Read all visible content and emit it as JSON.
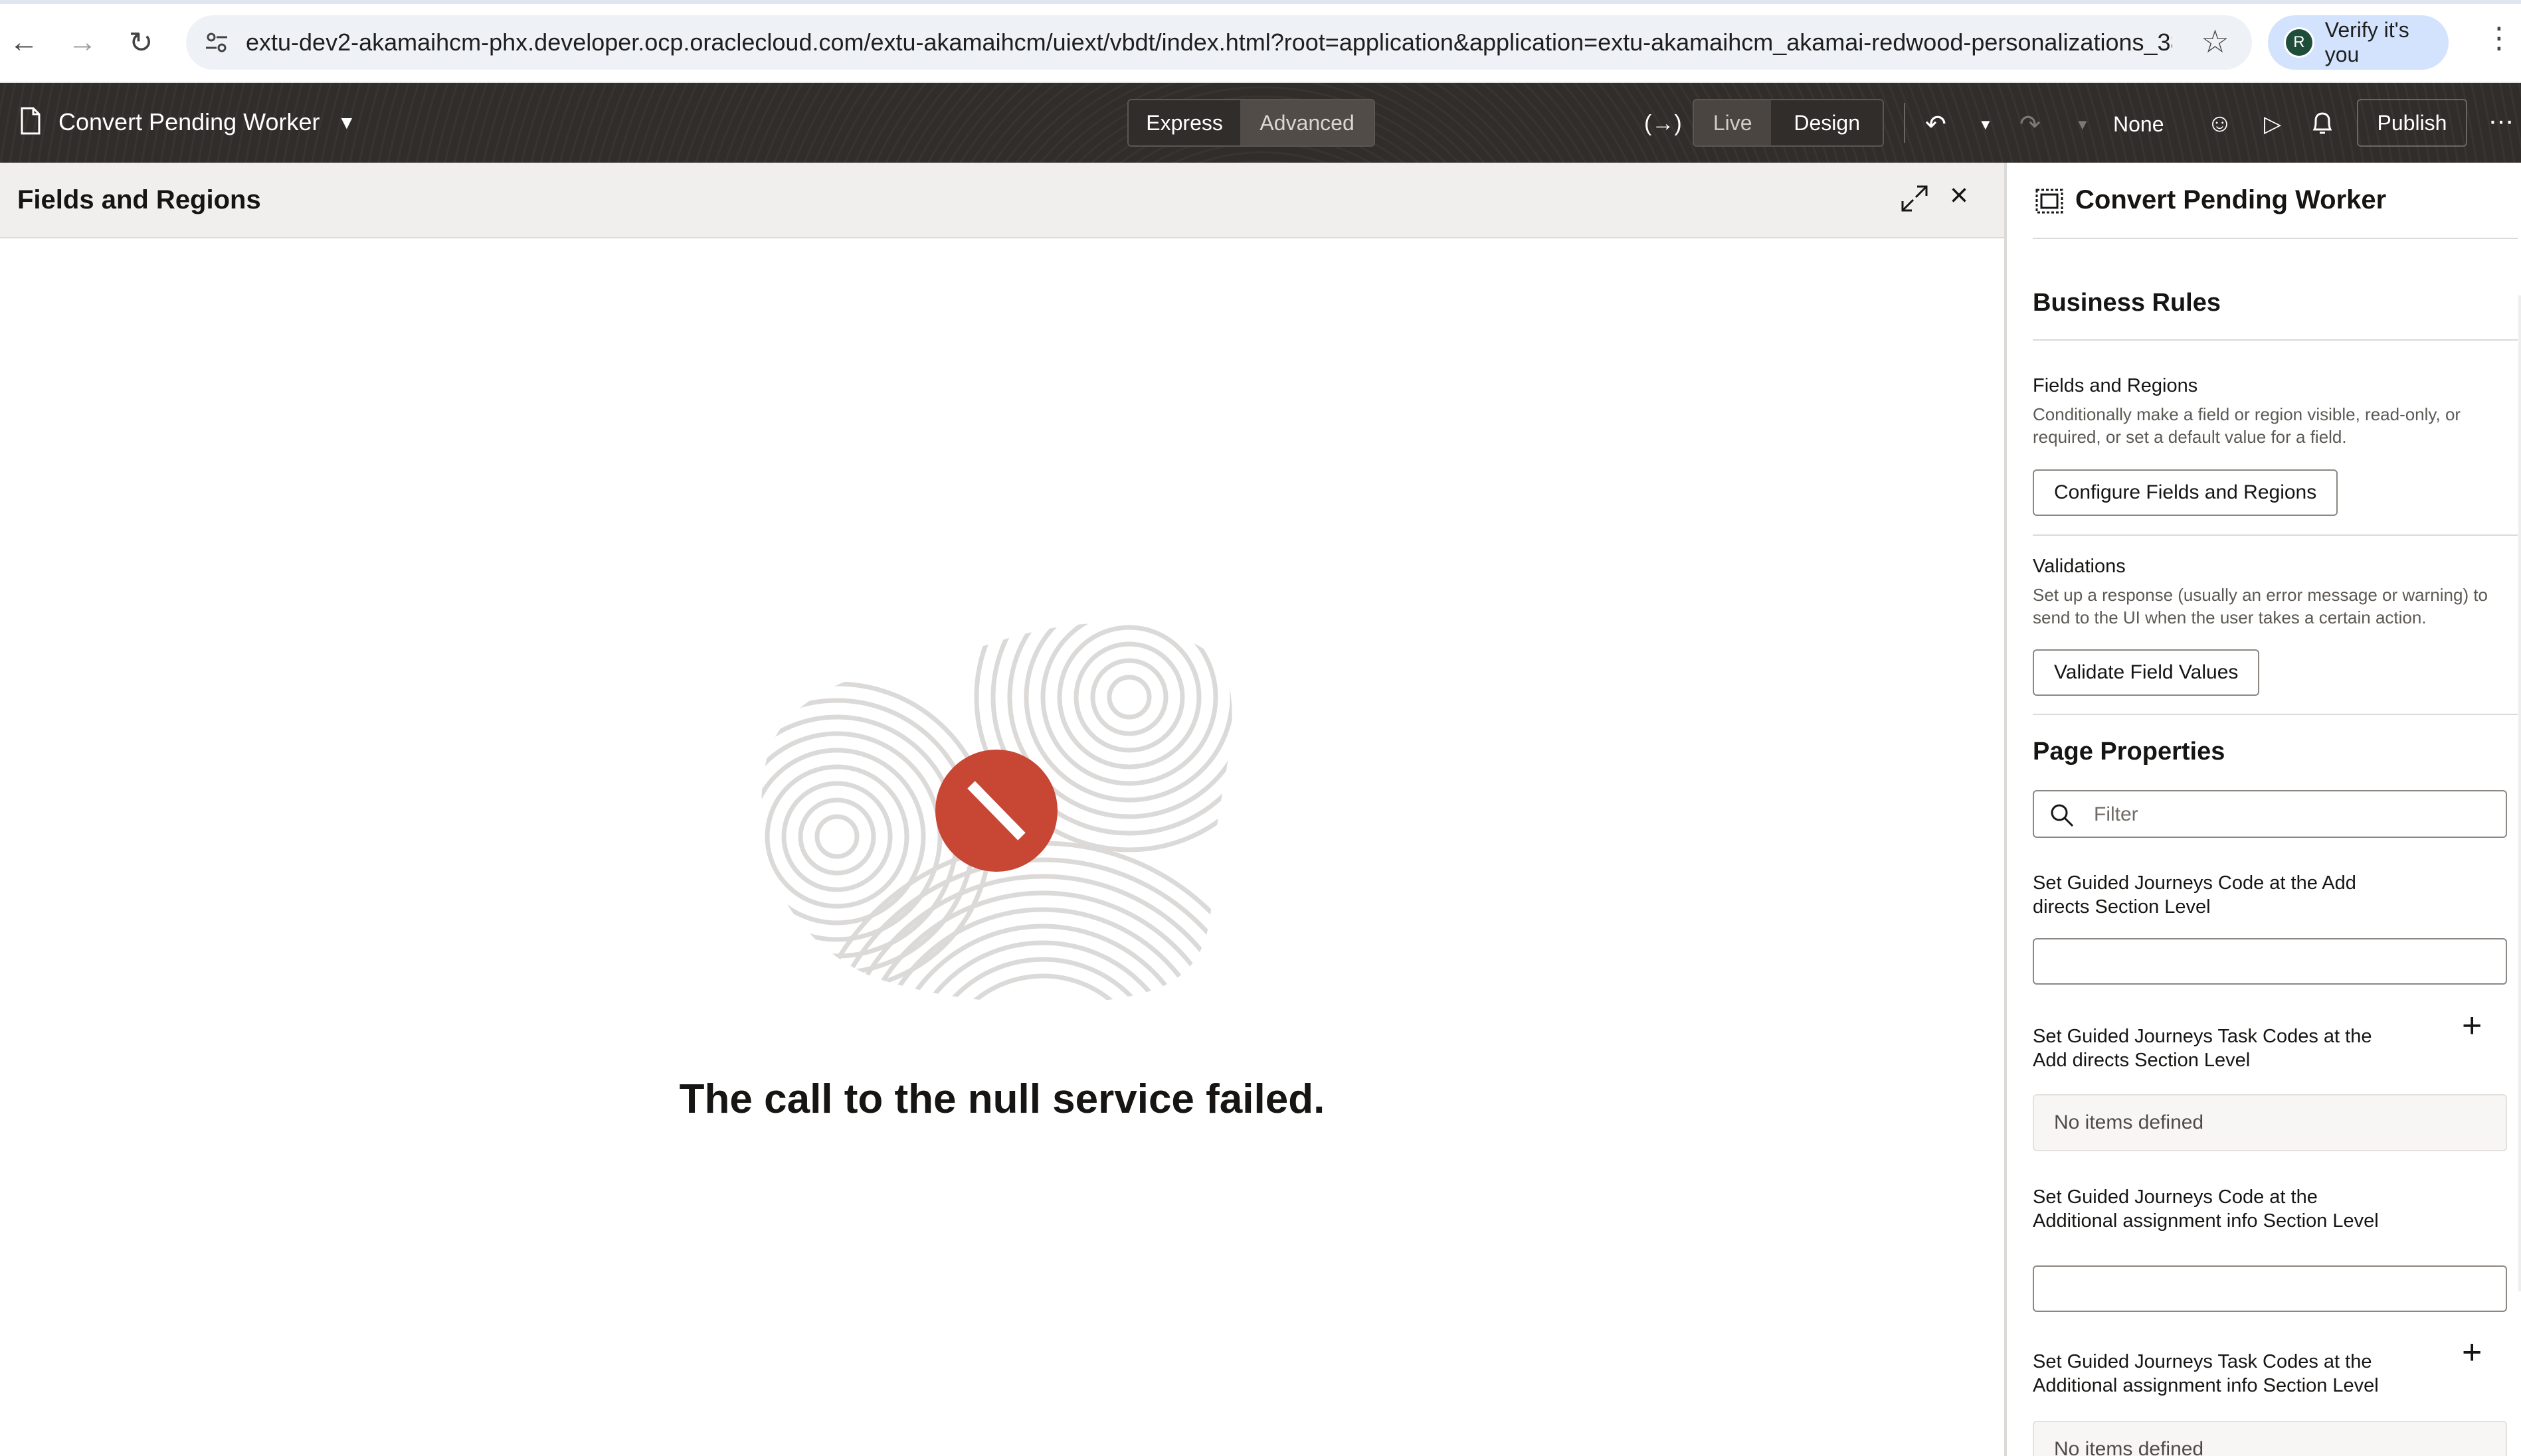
{
  "browser": {
    "url": "extu-dev2-akamaihcm-phx.developer.ocp.oraclecloud.com/extu-akamaihcm/uiext/vbdt/index.html?root=application&application=extu-akamaihcm_akamai-redwood-personalizations_38...",
    "profile_initial": "R",
    "profile_label": "Verify it's you"
  },
  "header": {
    "title": "Convert Pending Worker",
    "mode_express": "Express",
    "mode_advanced": "Advanced",
    "view_live": "Live",
    "view_design": "Design",
    "none_label": "None",
    "publish": "Publish"
  },
  "left": {
    "title": "Fields and Regions",
    "error_message": "The call to the null service failed."
  },
  "right": {
    "title": "Convert Pending Worker",
    "business_rules": "Business Rules",
    "fields_regions_label": "Fields and Regions",
    "fields_regions_desc": "Conditionally make a field or region visible, read-only, or required, or set a default value for a field.",
    "configure_button": "Configure Fields and Regions",
    "validations_label": "Validations",
    "validations_desc": "Set up a response (usually an error message or warning) to send to the UI when the user takes a certain action.",
    "validate_button": "Validate Field Values",
    "page_properties": "Page Properties",
    "filter_placeholder": "Filter",
    "fields": [
      {
        "label": "Set Guided Journeys Code at the Add directs Section Level"
      },
      {
        "label": "Set Guided Journeys Task Codes at the Add directs Section Level",
        "empty": "No items defined"
      },
      {
        "label": "Set Guided Journeys Code at the Additional assignment info Section Level"
      },
      {
        "label": "Set Guided Journeys Task Codes at the Additional assignment info Section Level",
        "empty": "No items defined"
      }
    ]
  },
  "colors": {
    "header_bg": "#312d2a",
    "error_icon": "#c74634",
    "omnibox_bg": "#eef1f6",
    "profile_chip": "#d3e3fd"
  }
}
